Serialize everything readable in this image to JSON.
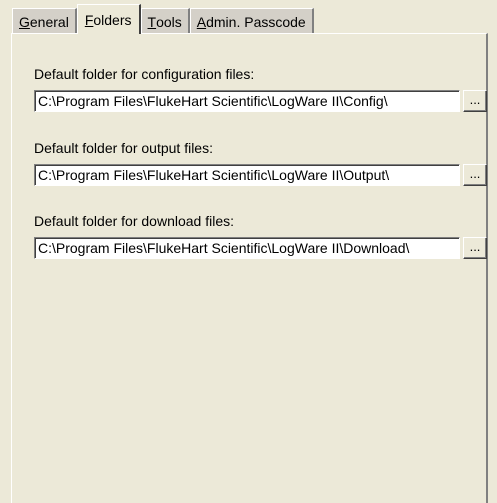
{
  "tabs": [
    {
      "prefix": "",
      "accel": "G",
      "rest": "eneral",
      "active": false
    },
    {
      "prefix": "",
      "accel": "F",
      "rest": "olders",
      "active": true
    },
    {
      "prefix": "",
      "accel": "T",
      "rest": "ools",
      "active": false
    },
    {
      "prefix": "",
      "accel": "A",
      "rest": "dmin. Passcode",
      "active": false
    }
  ],
  "folders": {
    "config": {
      "label": "Default folder for configuration files:",
      "value": "C:\\Program Files\\FlukeHart Scientific\\LogWare II\\Config\\",
      "browse_label": "..."
    },
    "output": {
      "label": "Default folder for output files:",
      "value": "C:\\Program Files\\FlukeHart Scientific\\LogWare II\\Output\\",
      "browse_label": "..."
    },
    "download": {
      "label": "Default folder for download files:",
      "value": "C:\\Program Files\\FlukeHart Scientific\\LogWare II\\Download\\",
      "browse_label": "..."
    }
  }
}
